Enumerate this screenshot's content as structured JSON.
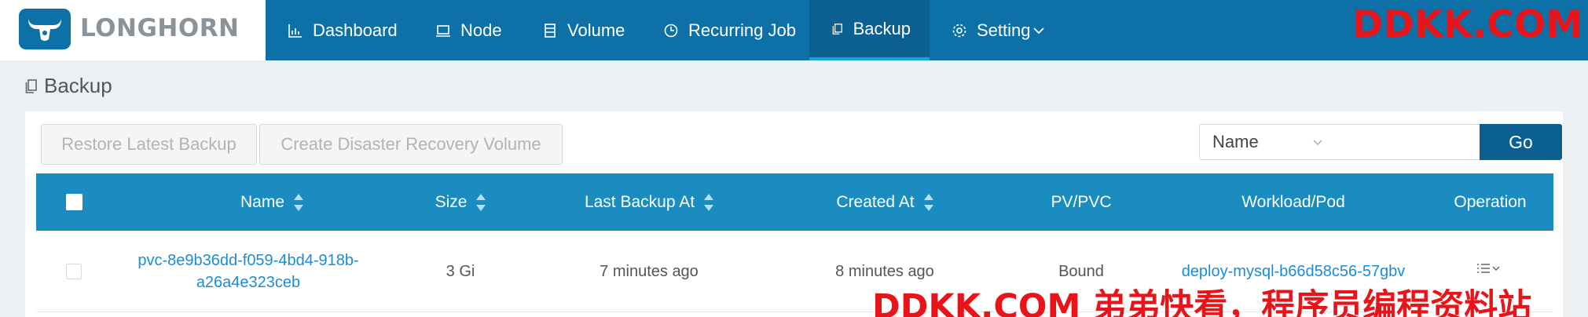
{
  "app": {
    "logo_text": "LONGHORN"
  },
  "nav": {
    "items": [
      {
        "label": "Dashboard"
      },
      {
        "label": "Node"
      },
      {
        "label": "Volume"
      },
      {
        "label": "Recurring Job"
      },
      {
        "label": "Backup",
        "active": true
      },
      {
        "label": "Setting",
        "has_dropdown": true
      }
    ]
  },
  "watermark": {
    "top": "DDKK.COM",
    "bottom": "DDKK.COM 弟弟快看，程序员编程资料站"
  },
  "page": {
    "title": "Backup"
  },
  "toolbar": {
    "restore_label": "Restore Latest Backup",
    "dr_label": "Create Disaster Recovery Volume",
    "filter_selected": "Name",
    "search_value": "",
    "go_label": "Go"
  },
  "table": {
    "columns": [
      "Name",
      "Size",
      "Last Backup At",
      "Created At",
      "PV/PVC",
      "Workload/Pod",
      "Operation"
    ],
    "rows": [
      {
        "name": "pvc-8e9b36dd-f059-4bd4-918b-a26a4e323ceb",
        "size": "3 Gi",
        "last_backup_at": "7 minutes ago",
        "created_at": "8 minutes ago",
        "pv_pvc": "Bound",
        "workload_pod": "deploy-mysql-b66d58c56-57gbv"
      }
    ]
  },
  "colors": {
    "nav_bg": "#0d71a8",
    "nav_active": "#0b5f91",
    "table_header": "#1a8cbf",
    "link": "#1a8cd8",
    "watermark": "#e8141a"
  }
}
